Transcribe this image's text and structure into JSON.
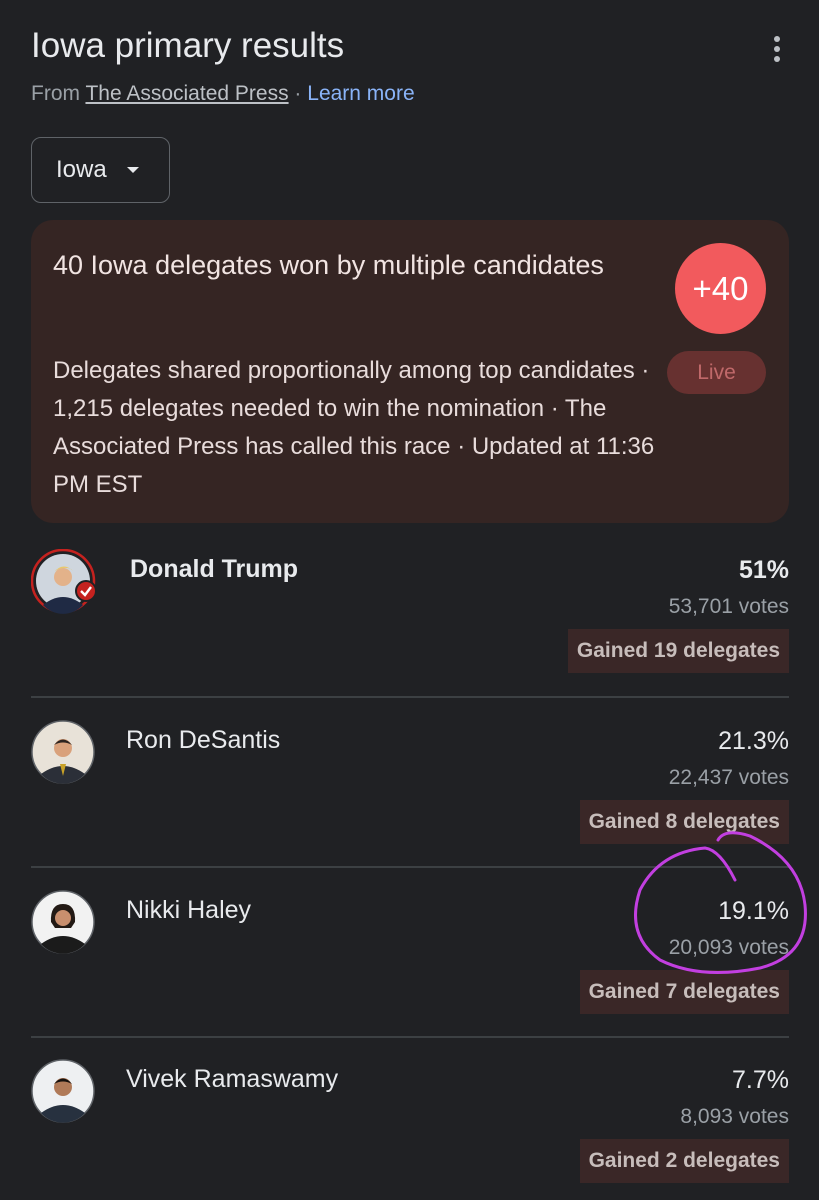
{
  "header": {
    "title": "Iowa primary results",
    "source_prefix": "From",
    "source_name": "The Associated Press",
    "separator": "·",
    "learn_more": "Learn more"
  },
  "state_selector": {
    "value": "Iowa"
  },
  "summary": {
    "headline": "40 Iowa delegates won by multiple candidates",
    "description": "Delegates shared proportionally among top candidates · 1,215 delegates needed to win the nomination · The Associated Press has called this race · Updated at 11:36 PM EST",
    "delegates_badge": "+40",
    "live_label": "Live",
    "badge_color": "#f25a5d"
  },
  "candidates": [
    {
      "name": "Donald Trump",
      "percent": "51%",
      "votes": "53,701 votes",
      "delegates": "Gained 19 delegates",
      "winner": true
    },
    {
      "name": "Ron DeSantis",
      "percent": "21.3%",
      "votes": "22,437 votes",
      "delegates": "Gained 8 delegates",
      "winner": false
    },
    {
      "name": "Nikki Haley",
      "percent": "19.1%",
      "votes": "20,093 votes",
      "delegates": "Gained 7 delegates",
      "winner": false
    },
    {
      "name": "Vivek Ramaswamy",
      "percent": "7.7%",
      "votes": "8,093 votes",
      "delegates": "Gained 2 delegates",
      "winner": false
    }
  ],
  "annotation_color": "#c23fe0"
}
